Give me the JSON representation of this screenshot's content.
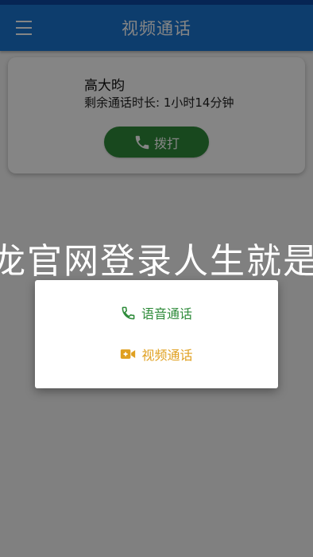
{
  "app_bar": {
    "title": "视频通话",
    "menu_icon": "hamburger-menu-icon"
  },
  "contact_card": {
    "name": "高大昀",
    "remaining_time": "剩余通话时长: 1小时14分钟",
    "call_button": {
      "label": "拨打",
      "icon": "phone-icon",
      "color": "#2e8b3a"
    }
  },
  "overlay_text": "龙官网登录人生就是博登",
  "call_type_dialog": {
    "options": [
      {
        "label": "语音通话",
        "icon": "phone-icon",
        "color": "#2e8b3a"
      },
      {
        "label": "视频通话",
        "icon": "video-camera-icon",
        "color": "#e0a020"
      }
    ]
  },
  "colors": {
    "app_bar": "#1976d2",
    "background": "#f5f5f5"
  }
}
